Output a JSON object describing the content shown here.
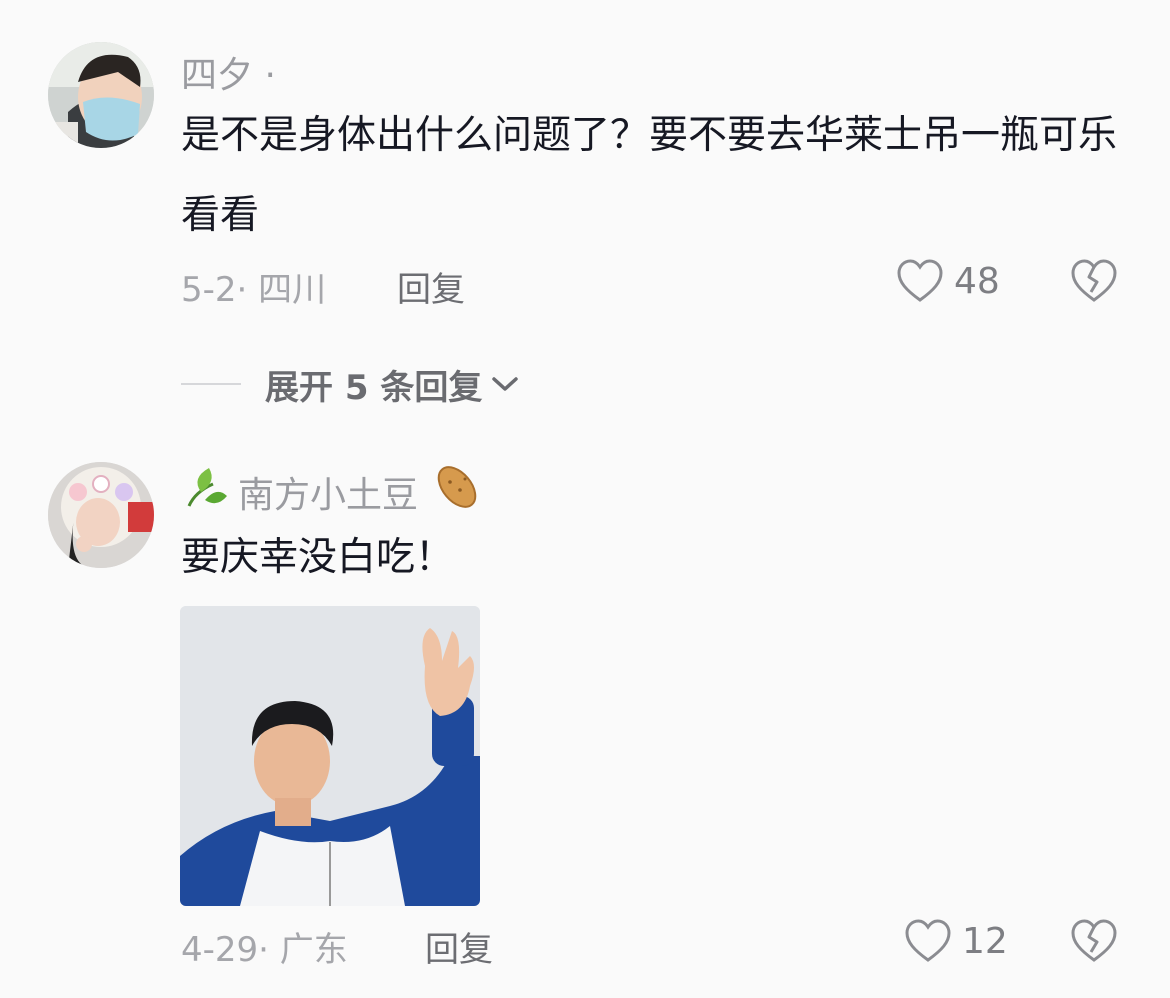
{
  "comments": [
    {
      "username": "四夕 ·",
      "text": "是不是身体出什么问题了？要不要去华莱士吊一瓶可乐看看",
      "meta": "5-2· 四川",
      "reply_label": "回复",
      "likes": "48",
      "avatar_icon": "avatar-masked-person"
    },
    {
      "username": "南方小土豆",
      "username_prefix_icon": "leaf-emoji",
      "username_suffix_icon": "potato-emoji",
      "text": "要庆幸没白吃！",
      "meta": "4-29· 广东",
      "reply_label": "回复",
      "likes": "12",
      "avatar_icon": "avatar-furry-hood-person",
      "image_icon": "waving-man-photo"
    }
  ],
  "expand_replies": {
    "label": "展开 5 条回复"
  },
  "colors": {
    "background": "#fafafa",
    "text": "#161823",
    "meta": "#a5a6ab"
  }
}
